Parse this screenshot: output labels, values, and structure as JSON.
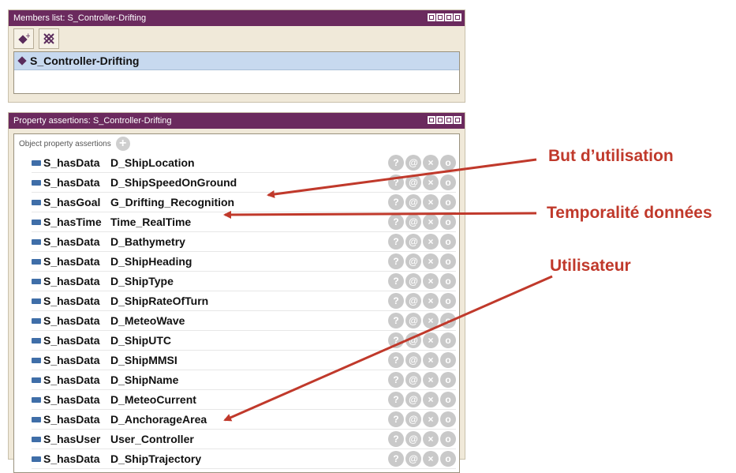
{
  "members": {
    "title": "Members list: S_Controller-Drifting",
    "toolbar": [
      "add-individual-icon",
      "delete-individual-icon"
    ],
    "items": [
      "S_Controller-Drifting"
    ]
  },
  "properties": {
    "title": "Property assertions: S_Controller-Drifting",
    "section_label": "Object property assertions",
    "rows": [
      {
        "prop": "S_hasData",
        "val": "D_ShipLocation"
      },
      {
        "prop": "S_hasData",
        "val": "D_ShipSpeedOnGround"
      },
      {
        "prop": "S_hasGoal",
        "val": "G_Drifting_Recognition"
      },
      {
        "prop": "S_hasTime",
        "val": "Time_RealTime"
      },
      {
        "prop": "S_hasData",
        "val": "D_Bathymetry"
      },
      {
        "prop": "S_hasData",
        "val": "D_ShipHeading"
      },
      {
        "prop": "S_hasData",
        "val": "D_ShipType"
      },
      {
        "prop": "S_hasData",
        "val": "D_ShipRateOfTurn"
      },
      {
        "prop": "S_hasData",
        "val": "D_MeteoWave"
      },
      {
        "prop": "S_hasData",
        "val": "D_ShipUTC"
      },
      {
        "prop": "S_hasData",
        "val": "D_ShipMMSI"
      },
      {
        "prop": "S_hasData",
        "val": "D_ShipName"
      },
      {
        "prop": "S_hasData",
        "val": "D_MeteoCurrent"
      },
      {
        "prop": "S_hasData",
        "val": "D_AnchorageArea"
      },
      {
        "prop": "S_hasUser",
        "val": "User_Controller"
      },
      {
        "prop": "S_hasData",
        "val": "D_ShipTrajectory"
      }
    ],
    "row_actions": [
      "?",
      "@",
      "×",
      "o"
    ]
  },
  "annotations": {
    "but": "But d’utilisation",
    "temporalite": "Temporalité données",
    "utilisateur": "Utilisateur",
    "color": "#c0392b"
  },
  "colors": {
    "header": "#6b2a5e",
    "panel_bg": "#f0e9d9",
    "selection": "#c7d9ef",
    "marker": "#3f6ea8"
  }
}
